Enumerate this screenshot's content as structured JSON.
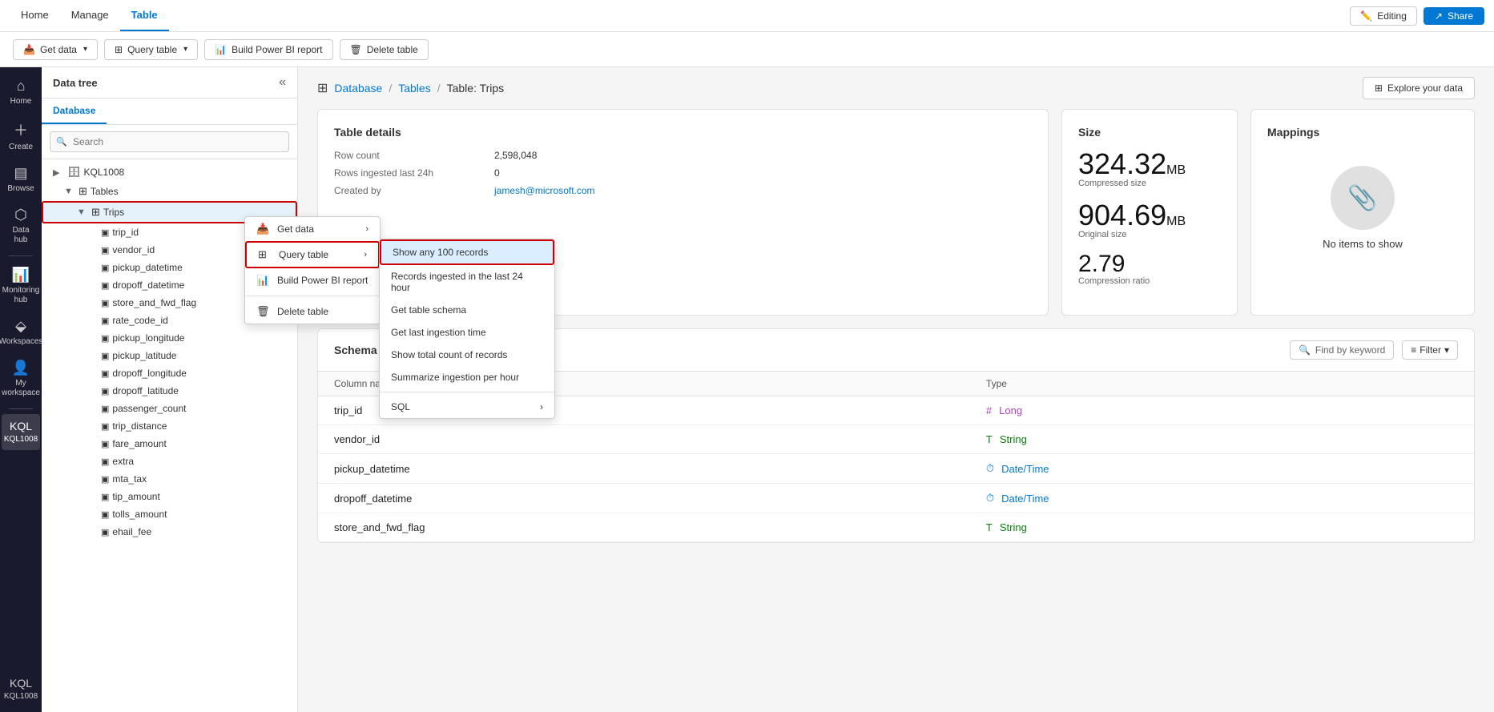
{
  "topbar": {
    "nav": [
      {
        "label": "Home",
        "active": false
      },
      {
        "label": "Manage",
        "active": false
      },
      {
        "label": "Table",
        "active": true
      }
    ],
    "editing_label": "Editing",
    "share_label": "Share"
  },
  "actionbar": {
    "get_data": "Get data",
    "query_table": "Query table",
    "build_report": "Build Power BI report",
    "delete_table": "Delete table"
  },
  "sidebar": {
    "title": "Data tree",
    "tabs": [
      {
        "label": "Database",
        "active": true
      }
    ],
    "search_placeholder": "Search",
    "tree": {
      "database": "KQL1008",
      "tables_label": "Tables",
      "items": [
        {
          "label": "Trips",
          "selected": true
        },
        {
          "label": "trip_id"
        },
        {
          "label": "vendor_id"
        },
        {
          "label": "pickup_datetime"
        },
        {
          "label": "dropoff_datetime"
        },
        {
          "label": "store_and_fwd_flag"
        },
        {
          "label": "rate_code_id"
        },
        {
          "label": "pickup_longitude"
        },
        {
          "label": "pickup_latitude"
        },
        {
          "label": "dropoff_longitude"
        },
        {
          "label": "dropoff_latitude"
        },
        {
          "label": "passenger_count"
        },
        {
          "label": "trip_distance"
        },
        {
          "label": "fare_amount"
        },
        {
          "label": "extra"
        },
        {
          "label": "mta_tax"
        },
        {
          "label": "tip_amount"
        },
        {
          "label": "tolls_amount"
        },
        {
          "label": "ehail_fee"
        }
      ]
    }
  },
  "nav_icons": [
    {
      "label": "Home",
      "symbol": "⌂",
      "active": false
    },
    {
      "label": "Create",
      "symbol": "+",
      "active": false
    },
    {
      "label": "Browse",
      "symbol": "▤",
      "active": false
    },
    {
      "label": "Data hub",
      "symbol": "⬡",
      "active": false
    },
    {
      "label": "Monitoring hub",
      "symbol": "📊",
      "active": false
    },
    {
      "label": "Workspaces",
      "symbol": "⬙",
      "active": false
    },
    {
      "label": "My workspace",
      "symbol": "👤",
      "active": false
    },
    {
      "label": "KQL1008",
      "symbol": "🗄",
      "active": true,
      "bottom": false
    },
    {
      "label": "KQL1008",
      "symbol": "🗄",
      "active": false,
      "bottom": true
    }
  ],
  "breadcrumb": {
    "icon": "⊞",
    "items": [
      "Database",
      "Tables",
      "Table: Trips"
    ],
    "links": [
      true,
      true,
      false
    ]
  },
  "explore_btn": "Explore your data",
  "table_details": {
    "title": "Table details",
    "row_count_label": "Row count",
    "row_count_value": "2,598,048",
    "rows_ingested_label": "Rows ingested last 24h",
    "rows_ingested_value": "0",
    "created_by_label": "Created by",
    "created_by_value": "jamesh@microsoft.com"
  },
  "size": {
    "title": "Size",
    "compressed_value": "324.32",
    "compressed_unit": "MB",
    "compressed_label": "Compressed size",
    "original_value": "904.69",
    "original_unit": "MB",
    "original_label": "Original size",
    "ratio_value": "2.79",
    "ratio_label": "Compression ratio"
  },
  "mappings": {
    "title": "Mappings",
    "empty_label": "No items to show"
  },
  "schema": {
    "title": "Schema",
    "find_placeholder": "Find by keyword",
    "filter_label": "Filter",
    "col_name_header": "Column name",
    "col_type_header": "Type",
    "columns": [
      {
        "name": "trip_id",
        "type": "Long",
        "type_class": "long",
        "icon": "#"
      },
      {
        "name": "vendor_id",
        "type": "String",
        "type_class": "string",
        "icon": "T"
      },
      {
        "name": "pickup_datetime",
        "type": "Date/Time",
        "type_class": "datetime",
        "icon": "⏱"
      },
      {
        "name": "dropoff_datetime",
        "type": "Date/Time",
        "type_class": "datetime",
        "icon": "⏱"
      },
      {
        "name": "store_and_fwd_flag",
        "type": "String",
        "type_class": "string",
        "icon": "T"
      }
    ]
  },
  "context_menu": {
    "get_data_label": "Get data",
    "query_table_label": "Query table",
    "build_report_label": "Build Power BI report",
    "delete_table_label": "Delete table"
  },
  "submenu": {
    "items": [
      {
        "label": "Show any 100 records",
        "highlighted": true
      },
      {
        "label": "Records ingested in the last 24 hour"
      },
      {
        "label": "Get table schema"
      },
      {
        "label": "Get last ingestion time"
      },
      {
        "label": "Show total count of records"
      },
      {
        "label": "Summarize ingestion per hour"
      },
      {
        "label": "SQL",
        "has_sub": true
      }
    ]
  }
}
